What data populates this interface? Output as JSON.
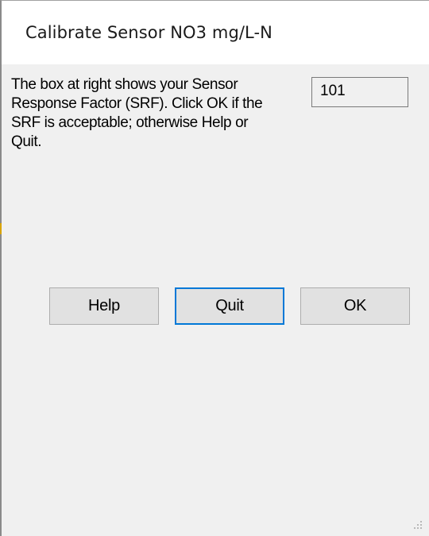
{
  "window": {
    "title": "Calibrate Sensor NO3 mg/L-N"
  },
  "dialog": {
    "message": "The box at right shows your Sensor Response Factor (SRF).  Click OK if the SRF is acceptable; otherwise Help or Quit.",
    "srf_value": "101"
  },
  "buttons": {
    "help_label": "Help",
    "quit_label": "Quit",
    "ok_label": "OK"
  },
  "colors": {
    "focus_border": "#0078d7",
    "dialog_background": "#f0f0f0",
    "button_background": "#e1e1e1"
  }
}
